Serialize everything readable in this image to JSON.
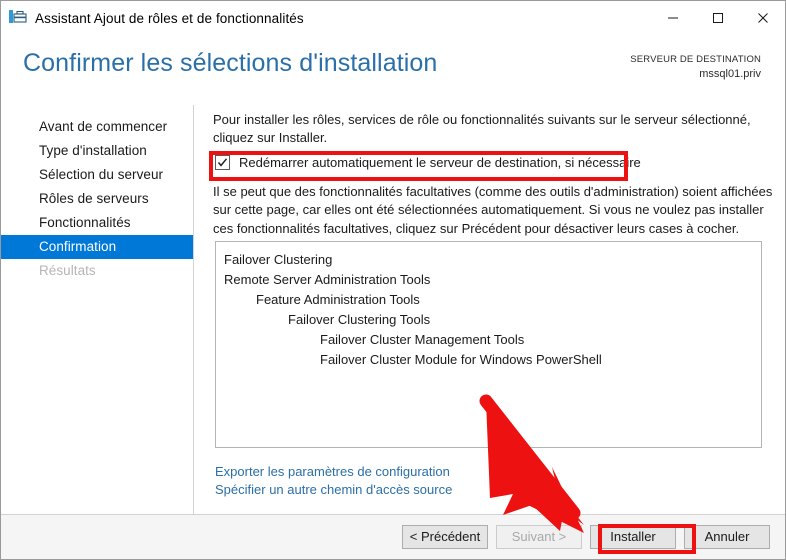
{
  "window": {
    "title": "Assistant Ajout de rôles et de fonctionnalités",
    "icon": "server-manager-icon",
    "controls": {
      "minimize": "minimize-icon",
      "maximize": "maximize-icon",
      "close": "close-icon"
    }
  },
  "header": {
    "page_title": "Confirmer les sélections d'installation",
    "destination_label": "SERVEUR DE DESTINATION",
    "destination_value": "mssql01.priv",
    "title_color": "#2a6fa8"
  },
  "sidebar": {
    "accent_color": "#0078d7",
    "items": [
      {
        "label": "Avant de commencer",
        "state": "normal"
      },
      {
        "label": "Type d'installation",
        "state": "normal"
      },
      {
        "label": "Sélection du serveur",
        "state": "normal"
      },
      {
        "label": "Rôles de serveurs",
        "state": "normal"
      },
      {
        "label": "Fonctionnalités",
        "state": "normal"
      },
      {
        "label": "Confirmation",
        "state": "active"
      },
      {
        "label": "Résultats",
        "state": "disabled"
      }
    ]
  },
  "main": {
    "intro_text": "Pour installer les rôles, services de rôle ou fonctionnalités suivants sur le serveur sélectionné, cliquez sur Installer.",
    "checkbox": {
      "label": "Redémarrer automatiquement le serveur de destination, si nécessaire",
      "checked": true
    },
    "note_text": "Il se peut que des fonctionnalités facultatives (comme des outils d'administration) soient affichées sur cette page, car elles ont été sélectionnées automatiquement. Si vous ne voulez pas installer ces fonctionnalités facultatives, cliquez sur Précédent pour désactiver leurs cases à cocher.",
    "features": [
      {
        "label": "Failover Clustering",
        "indent": 0
      },
      {
        "label": "Remote Server Administration Tools",
        "indent": 0
      },
      {
        "label": "Feature Administration Tools",
        "indent": 1
      },
      {
        "label": "Failover Clustering Tools",
        "indent": 2
      },
      {
        "label": "Failover Cluster Management Tools",
        "indent": 3
      },
      {
        "label": "Failover Cluster Module for Windows PowerShell",
        "indent": 3
      }
    ],
    "links": [
      "Exporter les paramètres de configuration",
      "Spécifier un autre chemin d'accès source"
    ]
  },
  "footer": {
    "buttons": [
      {
        "label": "< Précédent",
        "state": "normal"
      },
      {
        "label": "Suivant >",
        "state": "disabled"
      },
      {
        "label": "Installer",
        "state": "normal"
      },
      {
        "label": "Annuler",
        "state": "normal"
      }
    ]
  },
  "annotations": {
    "color": "#ee1111",
    "highlight_checkbox": true,
    "highlight_install_button": true,
    "arrow_points_to": "Installer"
  }
}
